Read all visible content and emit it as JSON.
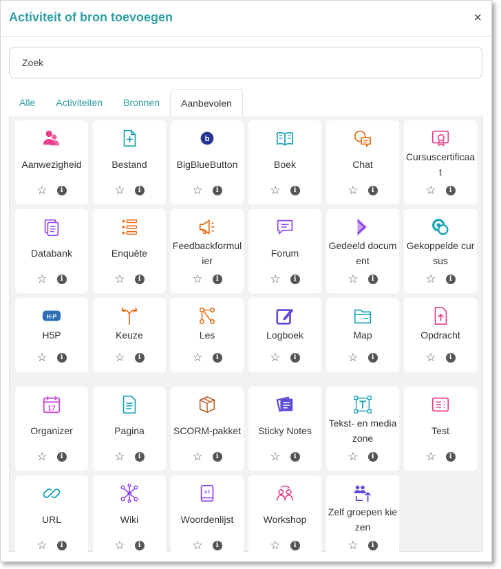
{
  "dialog": {
    "title": "Activiteit of bron toevoegen",
    "close": "×"
  },
  "search": {
    "placeholder": "Zoek"
  },
  "tabs": [
    {
      "label": "Alle",
      "active": false
    },
    {
      "label": "Activiteiten",
      "active": false
    },
    {
      "label": "Bronnen",
      "active": false
    },
    {
      "label": "Aanbevolen",
      "active": true
    }
  ],
  "actions": {
    "star": "☆",
    "info": "i"
  },
  "items": [
    {
      "name": "Aanwezigheid",
      "icon": "attendance-icon",
      "color": "#e83e8c"
    },
    {
      "name": "Bestand",
      "icon": "file-icon",
      "color": "#17a2b8"
    },
    {
      "name": "BigBlueButton",
      "icon": "bigbluebutton-icon",
      "color": "#283593"
    },
    {
      "name": "Boek",
      "icon": "book-icon",
      "color": "#17a2b8"
    },
    {
      "name": "Chat",
      "icon": "chat-icon",
      "color": "#e8690e"
    },
    {
      "name": "Cursuscertificaat",
      "icon": "certificate-icon",
      "color": "#e83e8c"
    },
    {
      "name": "Databank",
      "icon": "database-icon",
      "color": "#8e44ec"
    },
    {
      "name": "Enquête",
      "icon": "survey-icon",
      "color": "#e8690e"
    },
    {
      "name": "Feedbackformulier",
      "icon": "feedback-icon",
      "color": "#e8690e"
    },
    {
      "name": "Forum",
      "icon": "forum-icon",
      "color": "#8e44ec"
    },
    {
      "name": "Gedeeld document",
      "icon": "shared-document-icon",
      "color": "#8e44ec"
    },
    {
      "name": "Gekoppelde cursus",
      "icon": "linked-course-icon",
      "color": "#17a2b8"
    },
    {
      "name": "H5P",
      "icon": "h5p-icon",
      "color": "#2f6fb5"
    },
    {
      "name": "Keuze",
      "icon": "choice-icon",
      "color": "#e8690e"
    },
    {
      "name": "Les",
      "icon": "lesson-icon",
      "color": "#e8690e"
    },
    {
      "name": "Logboek",
      "icon": "journal-icon",
      "color": "#5b4bd6"
    },
    {
      "name": "Map",
      "icon": "folder-icon",
      "color": "#17a2b8"
    },
    {
      "name": "Opdracht",
      "icon": "assignment-icon",
      "color": "#e83e8c"
    },
    {
      "name": "Organizer",
      "icon": "calendar-icon",
      "color": "#c84bd6"
    },
    {
      "name": "Pagina",
      "icon": "page-icon",
      "color": "#17a2b8"
    },
    {
      "name": "SCORM-pakket",
      "icon": "package-icon",
      "color": "#b8632b"
    },
    {
      "name": "Sticky Notes",
      "icon": "sticky-notes-icon",
      "color": "#5b4bd6"
    },
    {
      "name": "Tekst- en mediazone",
      "icon": "text-media-icon",
      "color": "#17a2b8"
    },
    {
      "name": "Test",
      "icon": "quiz-icon",
      "color": "#e83e8c"
    },
    {
      "name": "URL",
      "icon": "link-icon",
      "color": "#17a2b8"
    },
    {
      "name": "Wiki",
      "icon": "wiki-icon",
      "color": "#8e44ec"
    },
    {
      "name": "Woordenlijst",
      "icon": "glossary-icon",
      "color": "#8e44ec"
    },
    {
      "name": "Workshop",
      "icon": "workshop-icon",
      "color": "#e83e8c"
    },
    {
      "name": "Zelf groepen kiezen",
      "icon": "group-choice-icon",
      "color": "#5b4bd6"
    }
  ]
}
